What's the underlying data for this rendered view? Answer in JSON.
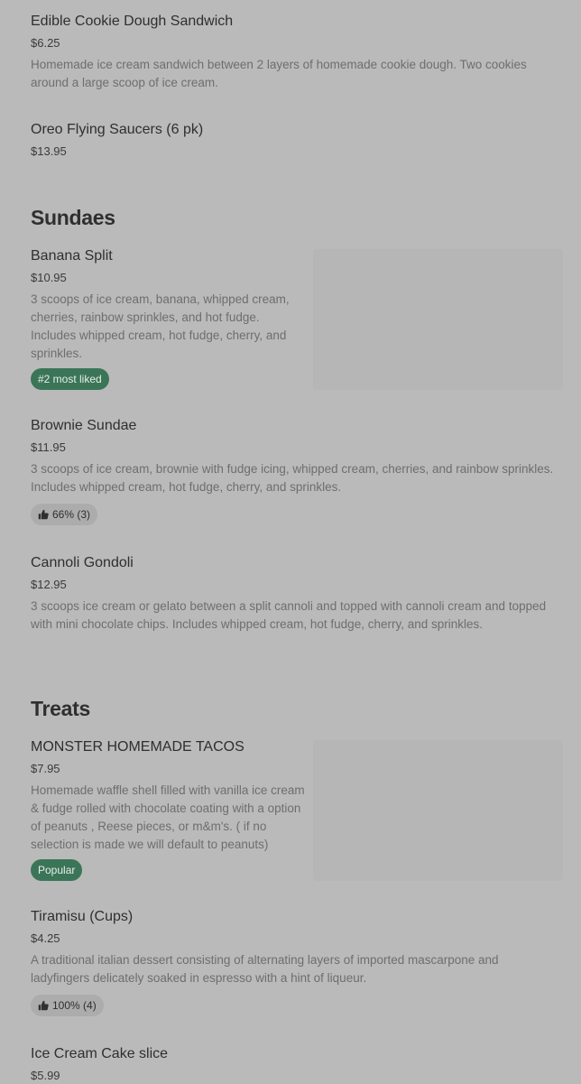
{
  "items_top": [
    {
      "name": "Edible Cookie Dough Sandwich",
      "price": "$6.25",
      "description": "Homemade ice cream sandwich between 2 layers of homemade cookie dough. Two cookies around a large scoop of ice cream."
    },
    {
      "name": "Oreo Flying Saucers (6 pk)",
      "price": "$13.95"
    }
  ],
  "sundaes": {
    "title": "Sundaes",
    "items": [
      {
        "name": "Banana Split",
        "price": "$10.95",
        "description": "3 scoops of ice cream, banana, whipped cream, cherries, rainbow sprinkles, and hot fudge. Includes whipped cream, hot fudge, cherry, and sprinkles.",
        "badge": "#2 most liked"
      },
      {
        "name": "Brownie Sundae",
        "price": "$11.95",
        "description": "3 scoops of ice cream, brownie with fudge icing, whipped cream, cherries, and rainbow sprinkles. Includes whipped cream, hot fudge, cherry, and sprinkles.",
        "rating": "66% (3)"
      },
      {
        "name": "Cannoli Gondoli",
        "price": "$12.95",
        "description": "3 scoops ice cream or gelato between a split cannoli and topped with cannoli cream and topped with mini chocolate chips. Includes whipped cream, hot fudge, cherry, and sprinkles."
      }
    ]
  },
  "treats": {
    "title": "Treats",
    "items": [
      {
        "name": "MONSTER HOMEMADE TACOS",
        "price": "$7.95",
        "description": "Homemade waffle shell filled with vanilla ice cream & fudge rolled with chocolate coating with a option of peanuts , Reese pieces, or m&m's. ( if no selection is made we will default to peanuts)",
        "badge": "Popular"
      },
      {
        "name": "Tiramisu (Cups)",
        "price": "$4.25",
        "description": "A traditional italian dessert consisting of alternating layers of imported mascarpone and ladyfingers delicately soaked in espresso with a hint of liqueur.",
        "rating": "100% (4)"
      },
      {
        "name": "Ice Cream Cake slice",
        "price": "$5.99"
      }
    ]
  },
  "icons": {
    "thumbs_up": "thumbs-up-icon"
  },
  "colors": {
    "badge_green": "#3b7557",
    "background": "#bababa"
  }
}
